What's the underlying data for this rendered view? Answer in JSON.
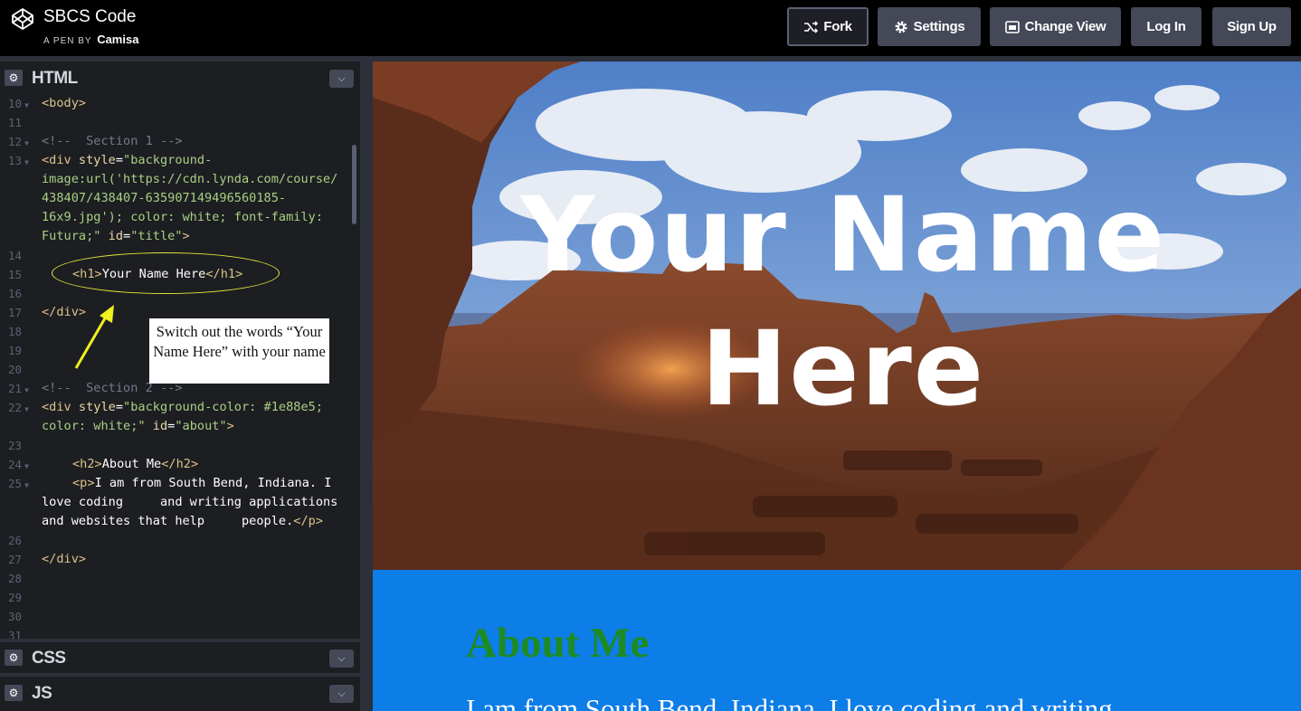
{
  "header": {
    "app_title": "SBCS Code",
    "pen_by_label": "A PEN BY",
    "author": "Camisa",
    "buttons": {
      "fork": "Fork",
      "settings": "Settings",
      "change_view": "Change View",
      "log_in": "Log In",
      "sign_up": "Sign Up"
    }
  },
  "editor": {
    "html_label": "HTML",
    "css_label": "CSS",
    "js_label": "JS",
    "line_numbers": [
      "10",
      "11",
      "12",
      "13",
      "",
      "",
      "",
      "",
      "14",
      "15",
      "16",
      "17",
      "18",
      "19",
      "20",
      "21",
      "22",
      "",
      "23",
      "24",
      "25",
      "",
      "",
      "26",
      "27",
      "28",
      "29",
      "30",
      "31"
    ],
    "lines": {
      "l10_tag": "<body>",
      "l12_comment": "<!--  Section 1 -->",
      "l13_a": "<div",
      "l13_b": " style",
      "l13_c": "=",
      "l13_d": "\"background-",
      "l13_e": "image:url('https://cdn.lynda.com/course/",
      "l13_f": "438407/438407-635907149496560185-",
      "l13_g": "16x9.jpg'); color: white; font-family:",
      "l13_h": "Futura;\"",
      "l13_i": " id",
      "l13_j": "=",
      "l13_k": "\"title\"",
      "l13_l": ">",
      "l15_open": "<h1>",
      "l15_text": "Your Name Here",
      "l15_close": "</h1>",
      "l17_tag": "</div>",
      "l21_comment": "<!--  Section 2 -->",
      "l22_a": "<div",
      "l22_b": " style",
      "l22_c": "=",
      "l22_d": "\"background-color: #1e88e5;",
      "l22_e": "color: white;\"",
      "l22_f": " id",
      "l22_g": "=",
      "l22_h": "\"about\"",
      "l22_i": ">",
      "l24_open": "<h2>",
      "l24_text": "About Me",
      "l24_close": "</h2>",
      "l25_open": "<p>",
      "l25_text1": "I am from South Bend, Indiana. I",
      "l25_text2": "love coding     and writing applications",
      "l25_text3": "and websites that help     people.",
      "l25_close": "</p>",
      "l27_tag": "</div>"
    }
  },
  "annotation": {
    "callout_text": "Switch out the words “Your Name Here” with your name"
  },
  "preview": {
    "hero_title": "Your Name Here",
    "about_title": "About Me",
    "about_text": "I am from South Bend, Indiana. I love coding and writing"
  },
  "colors": {
    "about_bg": "#0d7de8",
    "about_title": "#1e8b22",
    "annotation": "#e6e63c"
  }
}
